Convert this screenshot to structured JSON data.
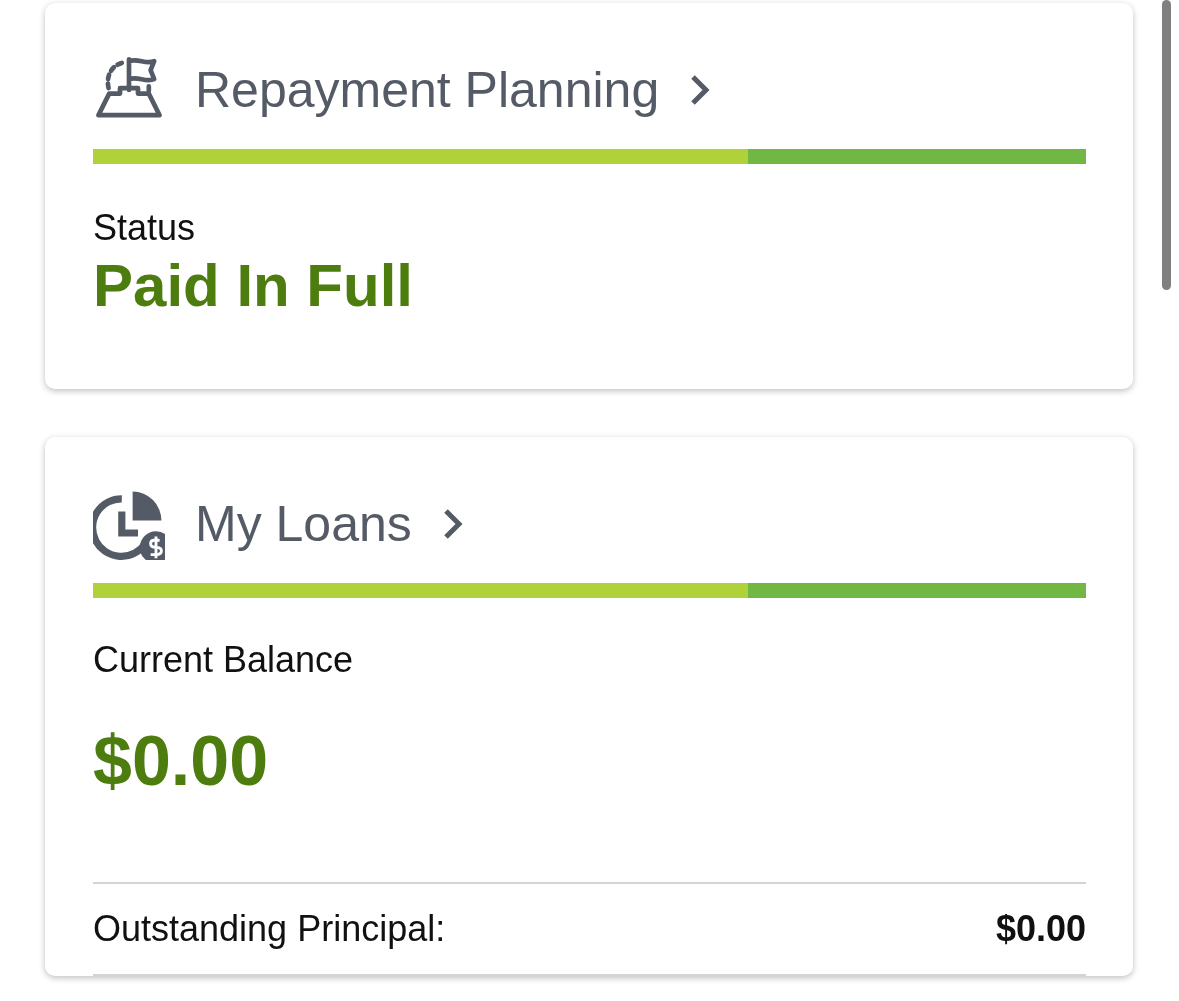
{
  "cards": [
    {
      "kind": "planning",
      "title": "Repayment Planning",
      "level": 0.66,
      "label": "Status",
      "value": "Paid In Full"
    },
    {
      "kind": "loans",
      "title": "My Loans",
      "level": 0.66,
      "label": "Current Balance",
      "value": "$0.00",
      "rows": [
        {
          "label": "Outstanding Principal:",
          "value": "$0.00"
        }
      ]
    }
  ]
}
